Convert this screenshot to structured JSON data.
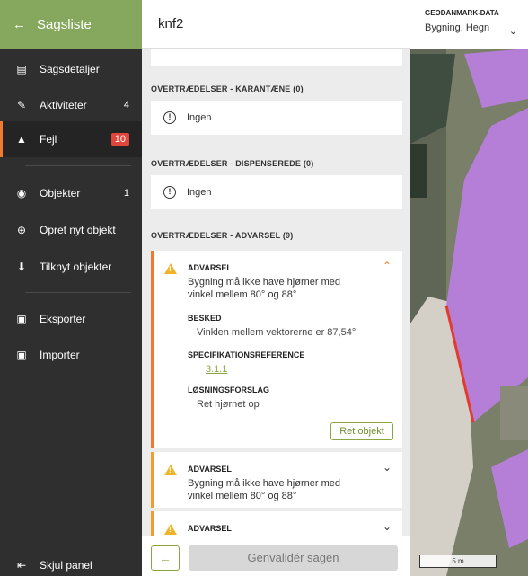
{
  "sidebar": {
    "header": "Sagsliste",
    "items": [
      {
        "label": "Sagsdetaljer",
        "icon": "clipboard-icon"
      },
      {
        "label": "Aktiviteter",
        "count": "4",
        "icon": "pencil-icon"
      },
      {
        "label": "Fejl",
        "count": "10",
        "icon": "warning-icon"
      },
      {
        "label": "Objekter",
        "count": "1",
        "icon": "location-icon"
      },
      {
        "label": "Opret nyt objekt",
        "icon": "plus-circle-icon"
      },
      {
        "label": "Tilknyt objekter",
        "icon": "download-box-icon"
      },
      {
        "label": "Eksporter",
        "icon": "briefcase-icon"
      },
      {
        "label": "Importer",
        "icon": "briefcase-icon"
      }
    ],
    "collapse_label": "Skjul panel"
  },
  "panel": {
    "title": "knf2",
    "sections": {
      "karantaene": "OVERTRÆDELSER - KARANTÆNE (0)",
      "dispenserede": "OVERTRÆDELSER - DISPENSEREDE (0)",
      "advarsel": "OVERTRÆDELSER - ADVARSEL (9)"
    },
    "none_label": "Ingen",
    "warnings": [
      {
        "type": "ADVARSEL",
        "text": "Bygning må ikke have hjørner med vinkel mellem 80° og 88°",
        "besked_label": "BESKED",
        "besked": "Vinklen mellem vektorerne er 87,54°",
        "spec_label": "SPECIFIKATIONSREFERENCE",
        "spec": "3.1.1",
        "fix_label": "LØSNINGSFORSLAG",
        "fix": "Ret hjørnet op",
        "button": "Ret objekt"
      },
      {
        "type": "ADVARSEL",
        "text": "Bygning må ikke have hjørner med vinkel mellem 80° og 88°"
      },
      {
        "type": "ADVARSEL"
      }
    ],
    "revalidate_button": "Genvalidér sagen"
  },
  "map": {
    "title": "GEODANMARK-DATA",
    "selection": "Bygning, Hegn",
    "scale": "5 m",
    "colors": {
      "building": "#b57fd8",
      "highlight": "#e23b2e"
    }
  }
}
